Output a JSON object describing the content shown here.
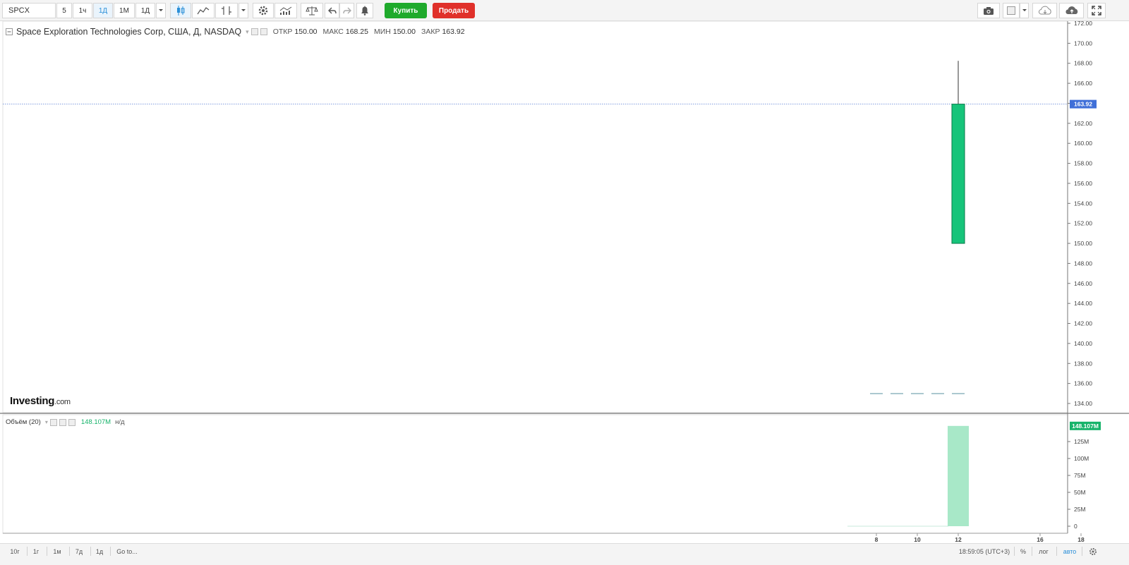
{
  "toolbar": {
    "symbol": "SPCX",
    "intervals": [
      "5",
      "1ч",
      "1Д",
      "1М",
      "1Д"
    ],
    "buy_label": "Купить",
    "sell_label": "Продать"
  },
  "legend": {
    "title": "Space Exploration Technologies Corp, США, Д, NASDAQ",
    "open_label": "ОТКР",
    "open": "150.00",
    "high_label": "МАКС",
    "high": "168.25",
    "low_label": "МИН",
    "low": "150.00",
    "close_label": "ЗАКР",
    "close": "163.92"
  },
  "volume_legend": {
    "title": "Объём (20)",
    "value": "148.107M",
    "ma": "н/д"
  },
  "logo": {
    "brand": "Investing",
    "suffix": ".com"
  },
  "bottom": {
    "ranges": [
      "10г",
      "1г",
      "1м",
      "7д",
      "1д",
      "Go to..."
    ],
    "clock": "18:59:05 (UTC+3)",
    "percent": "%",
    "log": "лог",
    "auto": "авто"
  },
  "colors": {
    "up": "#16c47a",
    "up_border": "#0a7a4a",
    "volume": "#a8e8c8",
    "last_price_tag": "#3f6fd8",
    "volume_tag": "#16b36a",
    "price_line": "#5b7fd6"
  },
  "chart_data": [
    {
      "type": "candlestick",
      "x_ticks": [
        "8",
        "10",
        "12",
        "16",
        "18"
      ],
      "candles": [
        {
          "x": "12",
          "open": 150.0,
          "high": 168.25,
          "low": 150.0,
          "close": 163.92
        }
      ],
      "y_ticks": [
        "172.00",
        "170.00",
        "168.00",
        "166.00",
        "164.00",
        "162.00",
        "160.00",
        "158.00",
        "156.00",
        "154.00",
        "152.00",
        "150.00",
        "148.00",
        "146.00",
        "144.00",
        "142.00",
        "140.00",
        "138.00",
        "136.00",
        "134.00"
      ],
      "ylim": [
        133.0,
        172.2
      ],
      "last_price": 163.92,
      "last_price_label": "163.92"
    },
    {
      "type": "bar",
      "title": "Объём (20)",
      "x": [
        "12"
      ],
      "values": [
        148107000
      ],
      "y_ticks": [
        "125M",
        "100M",
        "75M",
        "50M",
        "25M",
        "0"
      ],
      "y_tick_values": [
        125000000,
        100000000,
        75000000,
        50000000,
        25000000,
        0
      ],
      "ylim": [
        0,
        148107000
      ],
      "last_value_label": "148.107M"
    }
  ]
}
